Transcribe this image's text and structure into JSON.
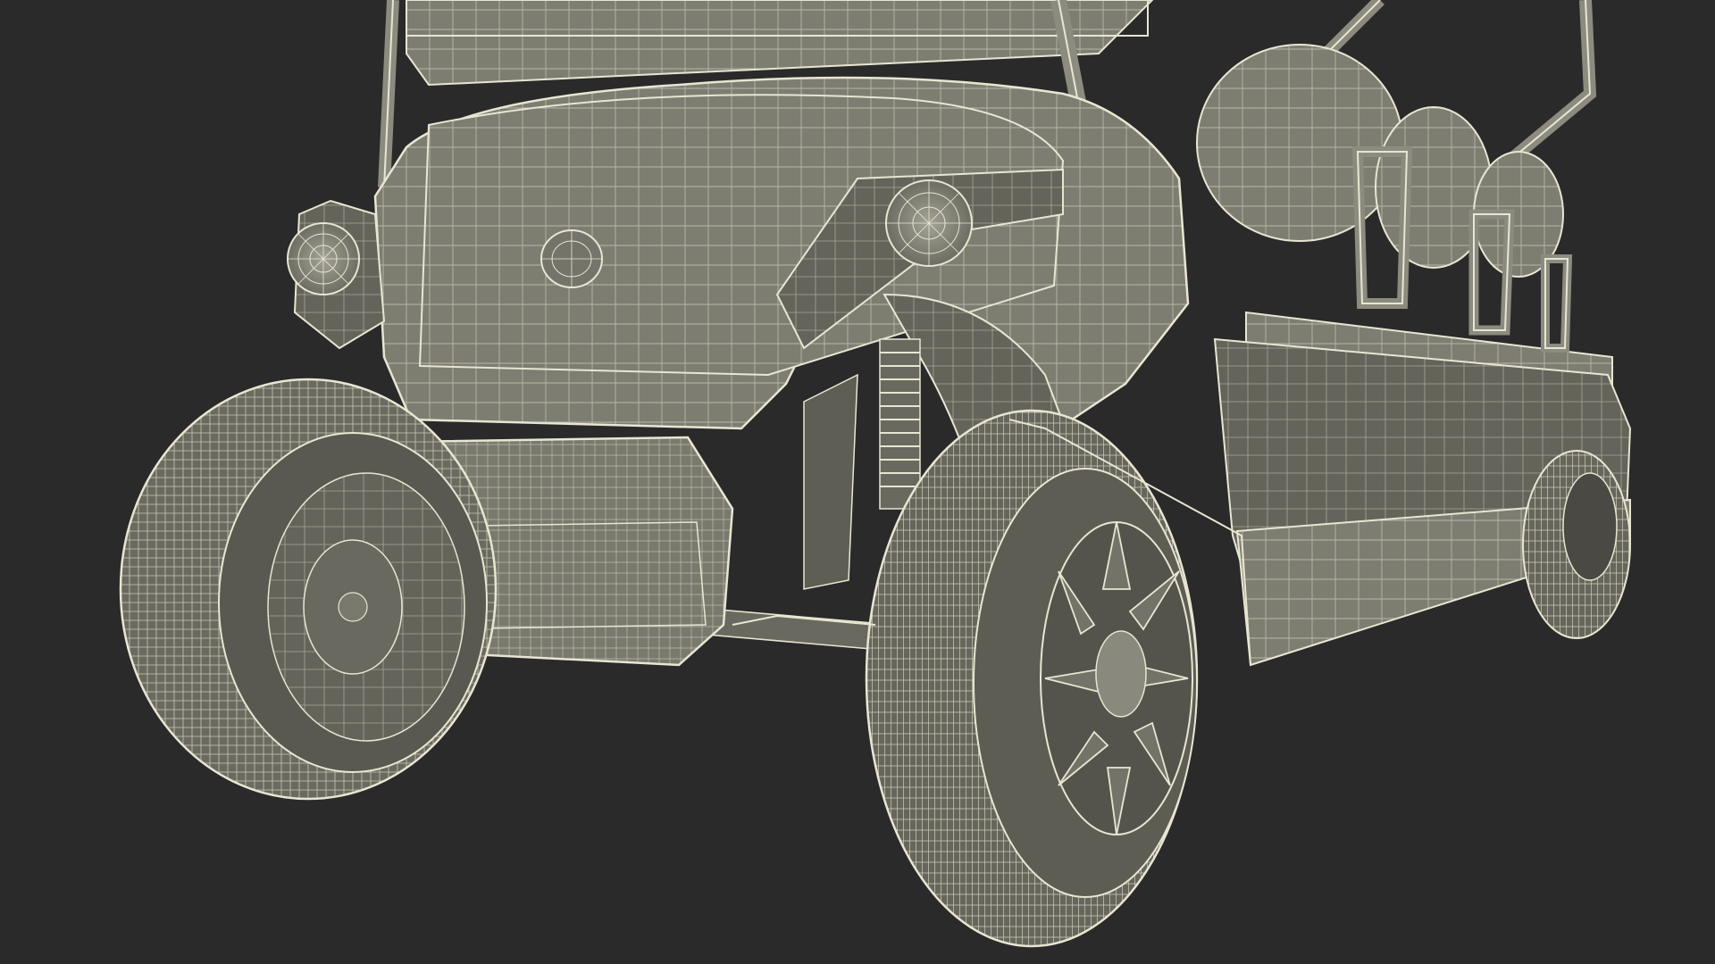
{
  "scene": {
    "subject": "golf-cart-wireframe",
    "colors": {
      "background": "#2a2a2a",
      "surface": "#7e7d72",
      "surface_dark": "#5f5e55",
      "surface_light": "#9a998c",
      "wire": "#e8e6d2",
      "tire": "#6b6a60",
      "tire_dark": "#4a4943"
    }
  }
}
